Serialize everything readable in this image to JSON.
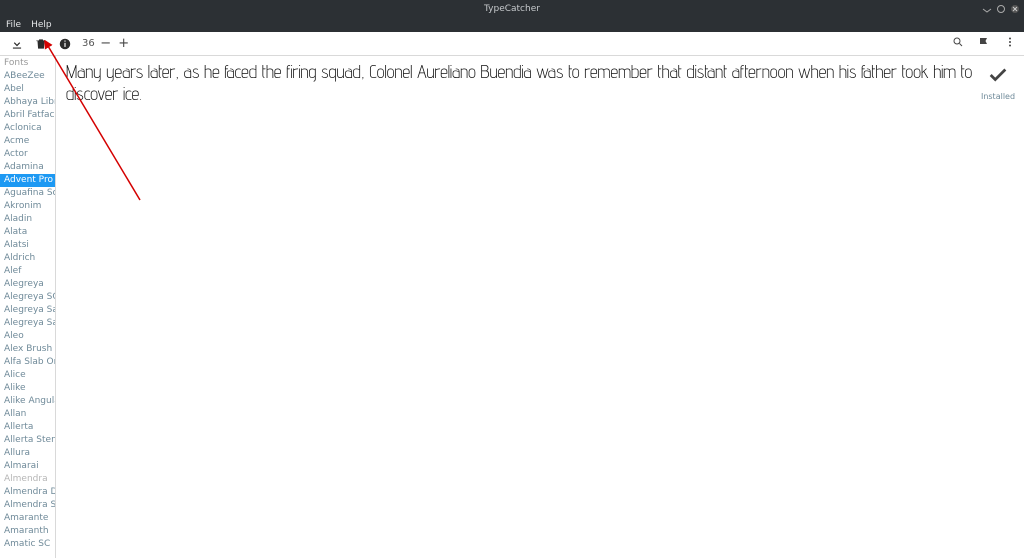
{
  "window": {
    "title": "TypeCatcher"
  },
  "menu": {
    "file": "File",
    "help": "Help"
  },
  "toolbar": {
    "size": "36",
    "minus": "−",
    "plus": "+"
  },
  "sidebar": {
    "header": "Fonts",
    "items": [
      {
        "label": "ABeeZee"
      },
      {
        "label": "Abel"
      },
      {
        "label": "Abhaya Libre"
      },
      {
        "label": "Abril Fatface"
      },
      {
        "label": "Aclonica"
      },
      {
        "label": "Acme"
      },
      {
        "label": "Actor"
      },
      {
        "label": "Adamina"
      },
      {
        "label": "Advent Pro",
        "selected": true
      },
      {
        "label": "Aguafina Script"
      },
      {
        "label": "Akronim"
      },
      {
        "label": "Aladin"
      },
      {
        "label": "Alata"
      },
      {
        "label": "Alatsi"
      },
      {
        "label": "Aldrich"
      },
      {
        "label": "Alef"
      },
      {
        "label": "Alegreya"
      },
      {
        "label": "Alegreya SC"
      },
      {
        "label": "Alegreya Sans"
      },
      {
        "label": "Alegreya Sans SC"
      },
      {
        "label": "Aleo"
      },
      {
        "label": "Alex Brush"
      },
      {
        "label": "Alfa Slab One"
      },
      {
        "label": "Alice"
      },
      {
        "label": "Alike"
      },
      {
        "label": "Alike Angular"
      },
      {
        "label": "Allan"
      },
      {
        "label": "Allerta"
      },
      {
        "label": "Allerta Stencil"
      },
      {
        "label": "Allura"
      },
      {
        "label": "Almarai"
      },
      {
        "label": "Almendra",
        "muted": true
      },
      {
        "label": "Almendra Display"
      },
      {
        "label": "Almendra SC"
      },
      {
        "label": "Amarante"
      },
      {
        "label": "Amaranth"
      },
      {
        "label": "Amatic SC"
      }
    ]
  },
  "preview": {
    "text": "Many years later, as he faced the firing squad, Colonel Aureliano Buendia was to remember that distant afternoon when his father took him to discover ice.",
    "status": "Installed"
  }
}
